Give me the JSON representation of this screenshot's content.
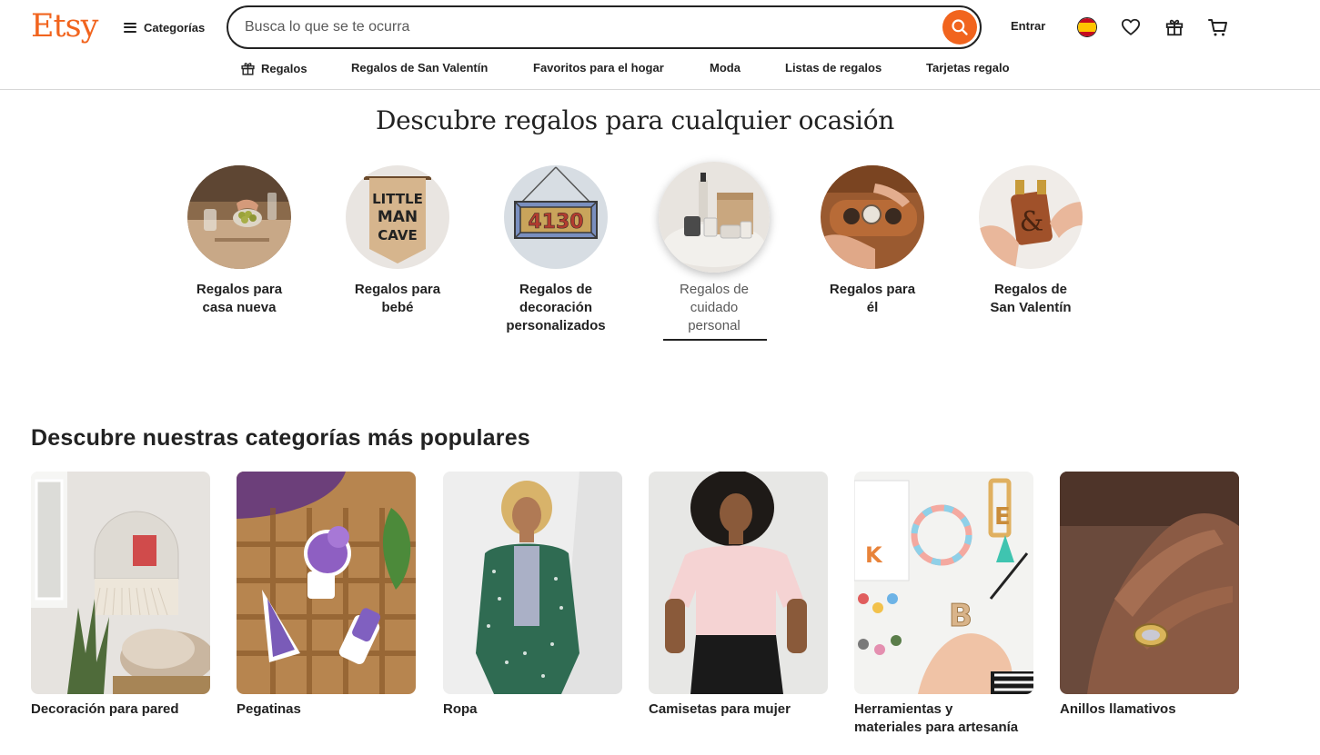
{
  "header": {
    "logo": "Etsy",
    "categories_label": "Categorías",
    "search_placeholder": "Busca lo que se te ocurra",
    "signin_label": "Entrar"
  },
  "subnav": [
    {
      "label": "Regalos",
      "icon": "gift-icon"
    },
    {
      "label": "Regalos de San Valentín"
    },
    {
      "label": "Favoritos para el hogar"
    },
    {
      "label": "Moda"
    },
    {
      "label": "Listas de regalos"
    },
    {
      "label": "Tarjetas regalo"
    }
  ],
  "gifts": {
    "title": "Descubre regalos para cualquier ocasión",
    "items": [
      {
        "label": "Regalos para casa nueva",
        "line1": "Regalos para",
        "line2": "casa nueva",
        "line3": ""
      },
      {
        "label": "Regalos para bebé",
        "line1": "Regalos para",
        "line2": "bebé",
        "line3": "",
        "image_text": [
          "LITTLE",
          "MAN",
          "CAVE"
        ]
      },
      {
        "label": "Regalos de decoración personalizados",
        "line1": "Regalos de",
        "line2": "decoración",
        "line3": "personalizados",
        "image_text": "4130"
      },
      {
        "label": "Regalos de cuidado personal",
        "line1": "Regalos de",
        "line2": "cuidado",
        "line3": "personal",
        "active": true
      },
      {
        "label": "Regalos para él",
        "line1": "Regalos para",
        "line2": "él",
        "line3": ""
      },
      {
        "label": "Regalos de San Valentín",
        "line1": "Regalos de",
        "line2": "San Valentín",
        "line3": ""
      }
    ]
  },
  "popular": {
    "title": "Descubre nuestras categorías más populares",
    "items": [
      {
        "label": "Decoración para pared",
        "line1": "Decoración para pared",
        "line2": ""
      },
      {
        "label": "Pegatinas",
        "line1": "Pegatinas",
        "line2": ""
      },
      {
        "label": "Ropa",
        "line1": "Ropa",
        "line2": ""
      },
      {
        "label": "Camisetas para mujer",
        "line1": "Camisetas para mujer",
        "line2": ""
      },
      {
        "label": "Herramientas y materiales para artesanía",
        "line1": "Herramientas y",
        "line2": "materiales para artesanía"
      },
      {
        "label": "Anillos llamativos",
        "line1": "Anillos llamativos",
        "line2": ""
      }
    ]
  },
  "colors": {
    "brand": "#f1641e",
    "text": "#222222",
    "muted": "#595959"
  }
}
